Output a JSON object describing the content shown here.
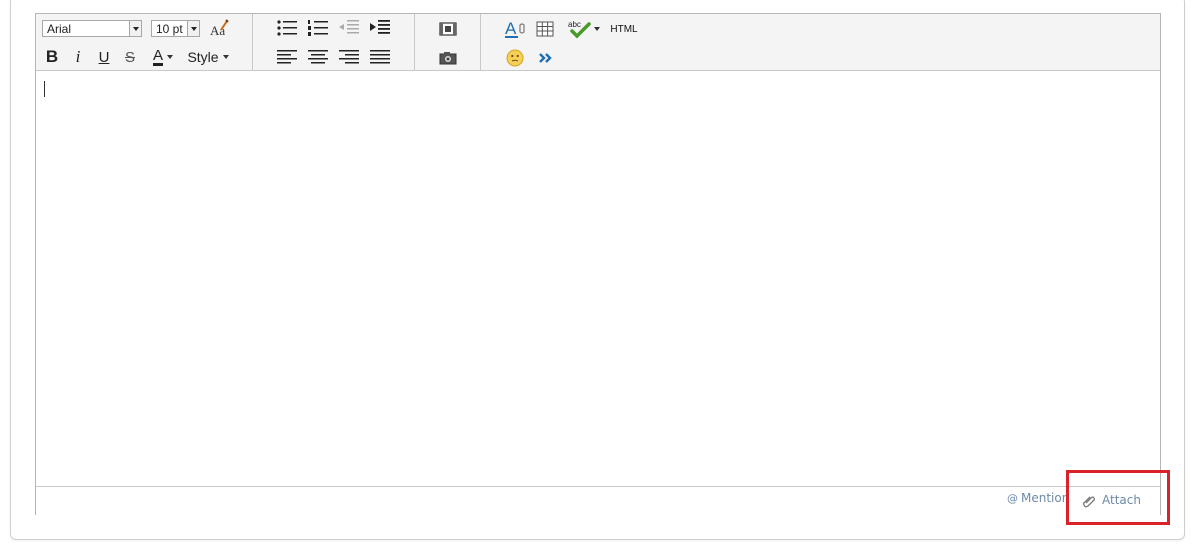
{
  "toolbar": {
    "font_family": "Arial",
    "font_size": "10 pt",
    "style_label": "Style",
    "html_label": "HTML",
    "bold": "B",
    "italic": "i",
    "underline": "U",
    "strike": "S",
    "font_color": "A"
  },
  "footer": {
    "mention_label": "Mention",
    "attach_label": "Attach"
  },
  "colors": {
    "highlight": "#d8232a",
    "link": "#6d8aa8",
    "toolbar_bg": "#f4f4f4"
  }
}
